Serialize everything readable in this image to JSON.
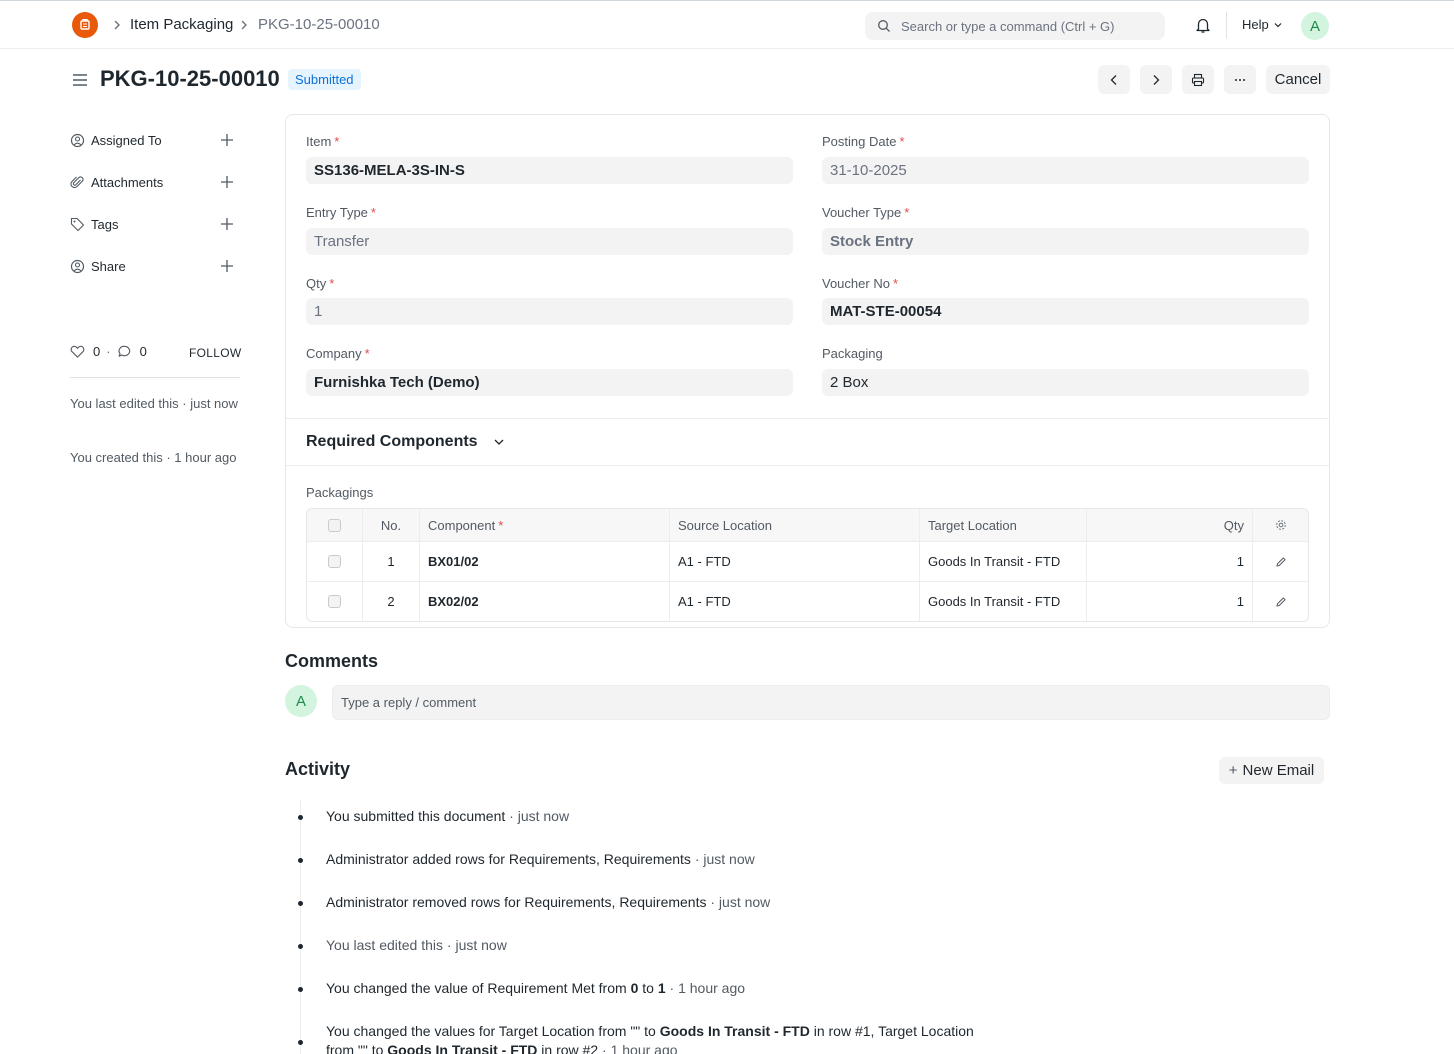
{
  "navbar": {
    "breadcrumbs": [
      "Item Packaging",
      "PKG-10-25-00010"
    ],
    "search_placeholder": "Search or type a command (Ctrl + G)",
    "help_label": "Help",
    "avatar_initial": "A"
  },
  "header": {
    "title": "PKG-10-25-00010",
    "status": "Submitted",
    "cancel_label": "Cancel"
  },
  "sidebar": {
    "items": [
      {
        "label": "Assigned To",
        "icon": "add-user-icon"
      },
      {
        "label": "Attachments",
        "icon": "paperclip-icon"
      },
      {
        "label": "Tags",
        "icon": "tag-icon"
      },
      {
        "label": "Share",
        "icon": "share-icon"
      }
    ],
    "likes": "0",
    "comments": "0",
    "follow_label": "FOLLOW",
    "notes": [
      "You last edited this · just now",
      "You created this · 1 hour ago"
    ]
  },
  "form": {
    "item": {
      "label": "Item",
      "value": "SS136-MELA-3S-IN-S"
    },
    "posting_date": {
      "label": "Posting Date",
      "value": "31-10-2025"
    },
    "entry_type": {
      "label": "Entry Type",
      "value": "Transfer"
    },
    "voucher_type": {
      "label": "Voucher Type",
      "value": "Stock Entry"
    },
    "qty": {
      "label": "Qty",
      "value": "1"
    },
    "voucher_no": {
      "label": "Voucher No",
      "value": "MAT-STE-00054"
    },
    "company": {
      "label": "Company",
      "value": "Furnishka Tech (Demo)"
    },
    "packaging": {
      "label": "Packaging",
      "value": "2 Box"
    }
  },
  "section": {
    "title": "Required Components",
    "table_label": "Packagings",
    "columns": [
      "No.",
      "Component",
      "Source Location",
      "Target Location",
      "Qty"
    ],
    "rows": [
      {
        "no": "1",
        "component": "BX01/02",
        "source": "A1 - FTD",
        "target": "Goods In Transit - FTD",
        "qty": "1"
      },
      {
        "no": "2",
        "component": "BX02/02",
        "source": "A1 - FTD",
        "target": "Goods In Transit - FTD",
        "qty": "1"
      }
    ]
  },
  "comments": {
    "title": "Comments",
    "placeholder": "Type a reply / comment",
    "avatar_initial": "A"
  },
  "activity": {
    "title": "Activity",
    "new_email_label": "New Email",
    "items": [
      {
        "text": "You submitted this document",
        "time": "· just now"
      },
      {
        "text": "Administrator added rows for Requirements, Requirements",
        "time": "· just now"
      },
      {
        "text": "Administrator removed rows for Requirements, Requirements",
        "time": "· just now"
      },
      {
        "text": "You last edited this",
        "time": "· just now"
      },
      {
        "pre": "You changed the value of Requirement Met from ",
        "from": "0",
        "mid": " to ",
        "to": "1",
        "time": " · 1 hour ago"
      },
      {
        "p1": "You changed the values for Target Location from \"\" to ",
        "b1": "Goods In Transit - FTD",
        "p2": " in row #1, Target Location",
        "p3": "from \"\" to ",
        "b2": "Goods In Transit - FTD",
        "p4": " in row #2",
        "time": " · 1 hour ago"
      }
    ]
  }
}
